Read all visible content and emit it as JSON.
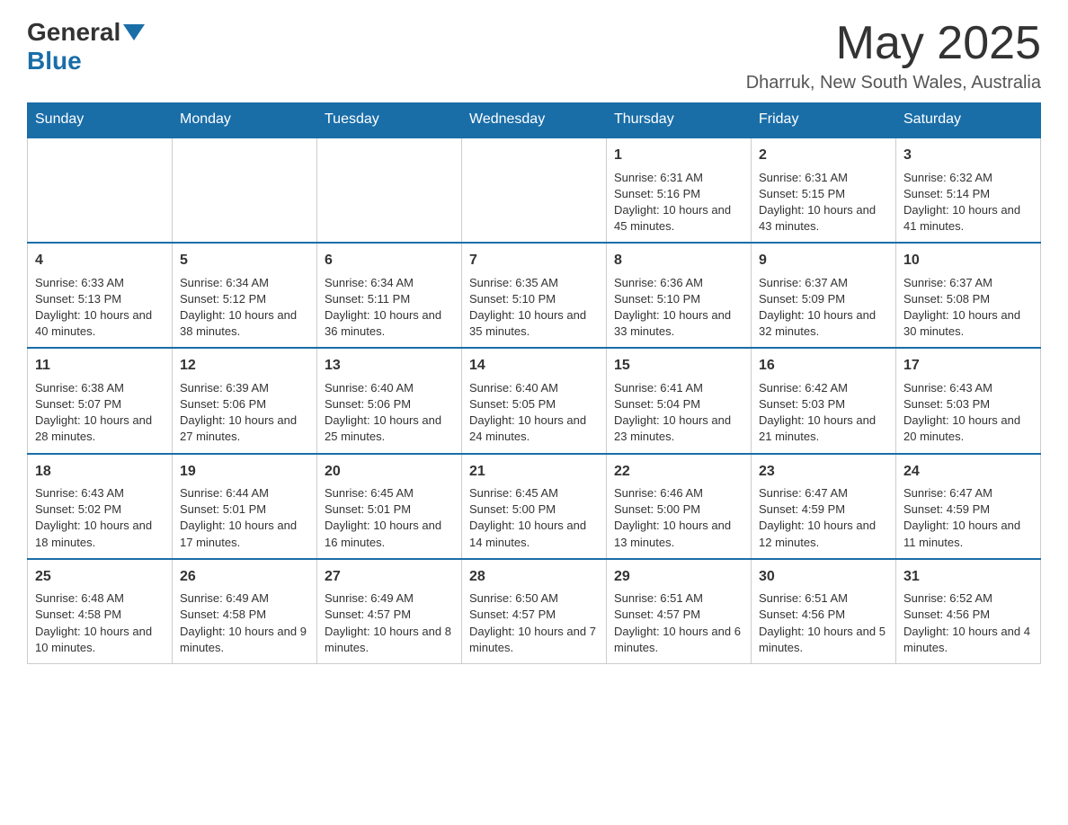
{
  "header": {
    "logo_general": "General",
    "logo_blue": "Blue",
    "month_title": "May 2025",
    "location": "Dharruk, New South Wales, Australia"
  },
  "days_of_week": [
    "Sunday",
    "Monday",
    "Tuesday",
    "Wednesday",
    "Thursday",
    "Friday",
    "Saturday"
  ],
  "weeks": [
    [
      {
        "day": "",
        "info": ""
      },
      {
        "day": "",
        "info": ""
      },
      {
        "day": "",
        "info": ""
      },
      {
        "day": "",
        "info": ""
      },
      {
        "day": "1",
        "info": "Sunrise: 6:31 AM\nSunset: 5:16 PM\nDaylight: 10 hours and 45 minutes."
      },
      {
        "day": "2",
        "info": "Sunrise: 6:31 AM\nSunset: 5:15 PM\nDaylight: 10 hours and 43 minutes."
      },
      {
        "day": "3",
        "info": "Sunrise: 6:32 AM\nSunset: 5:14 PM\nDaylight: 10 hours and 41 minutes."
      }
    ],
    [
      {
        "day": "4",
        "info": "Sunrise: 6:33 AM\nSunset: 5:13 PM\nDaylight: 10 hours and 40 minutes."
      },
      {
        "day": "5",
        "info": "Sunrise: 6:34 AM\nSunset: 5:12 PM\nDaylight: 10 hours and 38 minutes."
      },
      {
        "day": "6",
        "info": "Sunrise: 6:34 AM\nSunset: 5:11 PM\nDaylight: 10 hours and 36 minutes."
      },
      {
        "day": "7",
        "info": "Sunrise: 6:35 AM\nSunset: 5:10 PM\nDaylight: 10 hours and 35 minutes."
      },
      {
        "day": "8",
        "info": "Sunrise: 6:36 AM\nSunset: 5:10 PM\nDaylight: 10 hours and 33 minutes."
      },
      {
        "day": "9",
        "info": "Sunrise: 6:37 AM\nSunset: 5:09 PM\nDaylight: 10 hours and 32 minutes."
      },
      {
        "day": "10",
        "info": "Sunrise: 6:37 AM\nSunset: 5:08 PM\nDaylight: 10 hours and 30 minutes."
      }
    ],
    [
      {
        "day": "11",
        "info": "Sunrise: 6:38 AM\nSunset: 5:07 PM\nDaylight: 10 hours and 28 minutes."
      },
      {
        "day": "12",
        "info": "Sunrise: 6:39 AM\nSunset: 5:06 PM\nDaylight: 10 hours and 27 minutes."
      },
      {
        "day": "13",
        "info": "Sunrise: 6:40 AM\nSunset: 5:06 PM\nDaylight: 10 hours and 25 minutes."
      },
      {
        "day": "14",
        "info": "Sunrise: 6:40 AM\nSunset: 5:05 PM\nDaylight: 10 hours and 24 minutes."
      },
      {
        "day": "15",
        "info": "Sunrise: 6:41 AM\nSunset: 5:04 PM\nDaylight: 10 hours and 23 minutes."
      },
      {
        "day": "16",
        "info": "Sunrise: 6:42 AM\nSunset: 5:03 PM\nDaylight: 10 hours and 21 minutes."
      },
      {
        "day": "17",
        "info": "Sunrise: 6:43 AM\nSunset: 5:03 PM\nDaylight: 10 hours and 20 minutes."
      }
    ],
    [
      {
        "day": "18",
        "info": "Sunrise: 6:43 AM\nSunset: 5:02 PM\nDaylight: 10 hours and 18 minutes."
      },
      {
        "day": "19",
        "info": "Sunrise: 6:44 AM\nSunset: 5:01 PM\nDaylight: 10 hours and 17 minutes."
      },
      {
        "day": "20",
        "info": "Sunrise: 6:45 AM\nSunset: 5:01 PM\nDaylight: 10 hours and 16 minutes."
      },
      {
        "day": "21",
        "info": "Sunrise: 6:45 AM\nSunset: 5:00 PM\nDaylight: 10 hours and 14 minutes."
      },
      {
        "day": "22",
        "info": "Sunrise: 6:46 AM\nSunset: 5:00 PM\nDaylight: 10 hours and 13 minutes."
      },
      {
        "day": "23",
        "info": "Sunrise: 6:47 AM\nSunset: 4:59 PM\nDaylight: 10 hours and 12 minutes."
      },
      {
        "day": "24",
        "info": "Sunrise: 6:47 AM\nSunset: 4:59 PM\nDaylight: 10 hours and 11 minutes."
      }
    ],
    [
      {
        "day": "25",
        "info": "Sunrise: 6:48 AM\nSunset: 4:58 PM\nDaylight: 10 hours and 10 minutes."
      },
      {
        "day": "26",
        "info": "Sunrise: 6:49 AM\nSunset: 4:58 PM\nDaylight: 10 hours and 9 minutes."
      },
      {
        "day": "27",
        "info": "Sunrise: 6:49 AM\nSunset: 4:57 PM\nDaylight: 10 hours and 8 minutes."
      },
      {
        "day": "28",
        "info": "Sunrise: 6:50 AM\nSunset: 4:57 PM\nDaylight: 10 hours and 7 minutes."
      },
      {
        "day": "29",
        "info": "Sunrise: 6:51 AM\nSunset: 4:57 PM\nDaylight: 10 hours and 6 minutes."
      },
      {
        "day": "30",
        "info": "Sunrise: 6:51 AM\nSunset: 4:56 PM\nDaylight: 10 hours and 5 minutes."
      },
      {
        "day": "31",
        "info": "Sunrise: 6:52 AM\nSunset: 4:56 PM\nDaylight: 10 hours and 4 minutes."
      }
    ]
  ]
}
